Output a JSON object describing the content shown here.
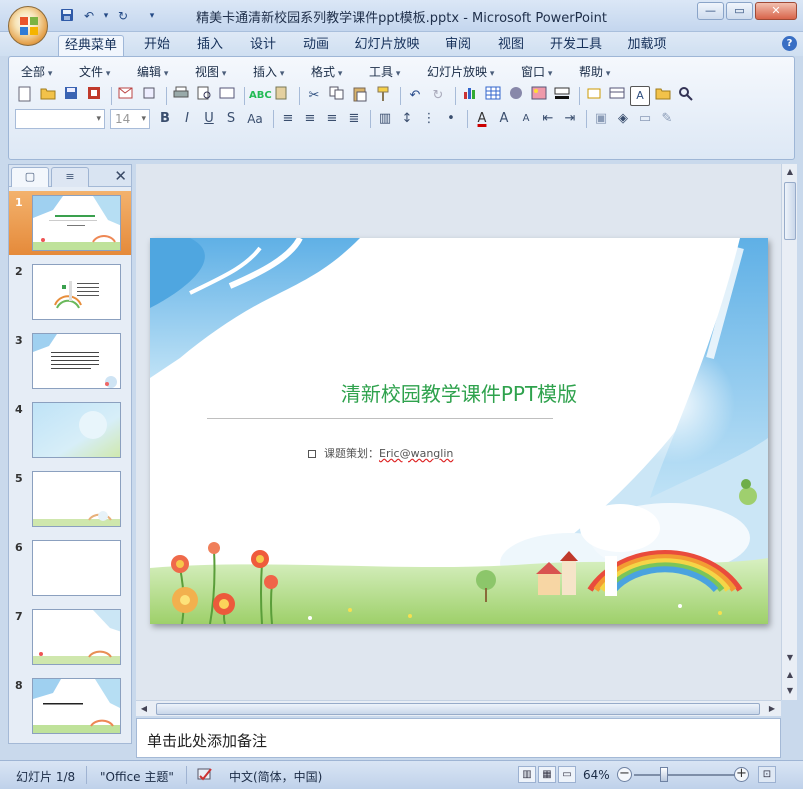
{
  "window": {
    "title": "精美卡通清新校园系列教学课件ppt模板.pptx - Microsoft PowerPoint",
    "minimize": "—",
    "restore": "▭",
    "close": "✕"
  },
  "qat": {
    "save": "💾",
    "undo": "↶",
    "undo_drop": "▾",
    "redo": "↻",
    "customize": "▾"
  },
  "tabs": [
    "经典菜单",
    "开始",
    "插入",
    "设计",
    "动画",
    "幻灯片放映",
    "审阅",
    "视图",
    "开发工具",
    "加载项"
  ],
  "help": "?",
  "menus": [
    "全部",
    "文件",
    "编辑",
    "视图",
    "插入",
    "格式",
    "工具",
    "幻灯片放映",
    "窗口",
    "帮助"
  ],
  "font_size_value": "14",
  "left_panel": {
    "tab_slides": "▢",
    "tab_outline": "≡",
    "close": "✕",
    "slides": [
      "1",
      "2",
      "3",
      "4",
      "5",
      "6",
      "7",
      "8"
    ]
  },
  "slide": {
    "title": "清新校园教学课件PPT模版",
    "subtitle_prefix": "课题策划：",
    "subtitle_author": "Eric@wanglin"
  },
  "notes_placeholder": "单击此处添加备注",
  "status": {
    "slide_counter": "幻灯片 1/8",
    "theme": "\"Office 主题\"",
    "language": "中文(简体，中国)",
    "zoom": "64%",
    "zoom_minus": "−",
    "zoom_plus": "+"
  },
  "colors": {
    "title_green": "#2fa24d",
    "selected_thumb": "#e58a3a",
    "ribbon_blue": "#dde8f5"
  },
  "icons": {
    "office_button": "office-logo-icon",
    "save": "save-icon",
    "undo": "undo-icon",
    "redo": "redo-icon",
    "help": "help-icon"
  }
}
